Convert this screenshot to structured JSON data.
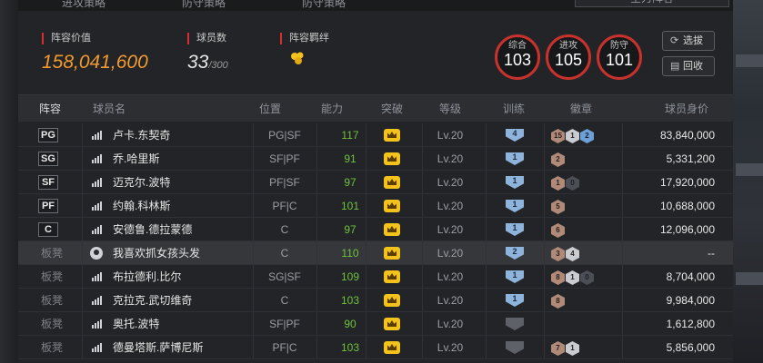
{
  "tabs": {
    "t1": "进攻策略",
    "t2": "防守策略",
    "t3": "防守策略",
    "selector": "全力阵容"
  },
  "summary": {
    "lineup_value_label": "阵容价值",
    "lineup_value": "158,041,600",
    "players_label": "球员数",
    "players_count": "33",
    "players_max": "/300",
    "bond_label": "阵容羁绊"
  },
  "ratings": [
    {
      "label": "综合",
      "value": "103"
    },
    {
      "label": "进攻",
      "value": "105"
    },
    {
      "label": "防守",
      "value": "101"
    }
  ],
  "buttons": {
    "select": "选拔",
    "recycle": "回收"
  },
  "columns": [
    "阵容",
    "球员名",
    "位置",
    "能力",
    "突破",
    "等级",
    "训练",
    "徽章",
    "球员身价"
  ],
  "rows": [
    {
      "slot": "PG",
      "name": "卢卡.东契奇",
      "pos": "PG|SF",
      "ability": "117",
      "level": "Lv.20",
      "train": "4",
      "badges": [
        {
          "t": "br",
          "v": "15"
        },
        {
          "t": "sv",
          "v": "1"
        },
        {
          "t": "bl",
          "v": "2"
        }
      ],
      "value": "83,840,000"
    },
    {
      "slot": "SG",
      "name": "乔.哈里斯",
      "pos": "SF|PF",
      "ability": "91",
      "level": "Lv.20",
      "train": "1",
      "badges": [
        {
          "t": "br",
          "v": "2"
        }
      ],
      "value": "5,331,200"
    },
    {
      "slot": "SF",
      "name": "迈克尔.波特",
      "pos": "PF|SF",
      "ability": "97",
      "level": "Lv.20",
      "train": "1",
      "badges": [
        {
          "t": "br",
          "v": "1"
        },
        {
          "t": "dk",
          "v": "0"
        }
      ],
      "value": "17,920,000"
    },
    {
      "slot": "PF",
      "name": "约翰.科林斯",
      "pos": "PF|C",
      "ability": "101",
      "level": "Lv.20",
      "train": "1",
      "badges": [
        {
          "t": "br",
          "v": "5"
        }
      ],
      "value": "10,688,000"
    },
    {
      "slot": "C",
      "name": "安德鲁.德拉蒙德",
      "pos": "C",
      "ability": "97",
      "level": "Lv.20",
      "train": "1",
      "badges": [
        {
          "t": "br",
          "v": "6"
        }
      ],
      "value": "12,096,000"
    },
    {
      "slot": "板凳",
      "name": "我喜欢抓女孩头发",
      "pos": "C",
      "ability": "110",
      "level": "Lv.20",
      "train": "2",
      "badges": [
        {
          "t": "br",
          "v": "3"
        },
        {
          "t": "sv",
          "v": "4"
        }
      ],
      "value": "--"
    },
    {
      "slot": "板凳",
      "name": "布拉德利.比尔",
      "pos": "SG|SF",
      "ability": "109",
      "level": "Lv.20",
      "train": "1",
      "badges": [
        {
          "t": "br",
          "v": "8"
        },
        {
          "t": "sv",
          "v": "1"
        },
        {
          "t": "dk",
          "v": "0"
        }
      ],
      "value": "8,704,000"
    },
    {
      "slot": "板凳",
      "name": "克拉克.武切维奇",
      "pos": "C",
      "ability": "103",
      "level": "Lv.20",
      "train": "1",
      "badges": [
        {
          "t": "br",
          "v": "8"
        }
      ],
      "value": "9,984,000"
    },
    {
      "slot": "板凳",
      "name": "奥托.波特",
      "pos": "SF|PF",
      "ability": "90",
      "level": "Lv.20",
      "train": "",
      "badges": [],
      "value": "1,612,800"
    },
    {
      "slot": "板凳",
      "name": "德曼塔斯.萨博尼斯",
      "pos": "PF|C",
      "ability": "103",
      "level": "Lv.20",
      "train": "",
      "badges": [
        {
          "t": "br",
          "v": "7"
        },
        {
          "t": "sv",
          "v": "1"
        }
      ],
      "value": "5,856,000"
    }
  ]
}
